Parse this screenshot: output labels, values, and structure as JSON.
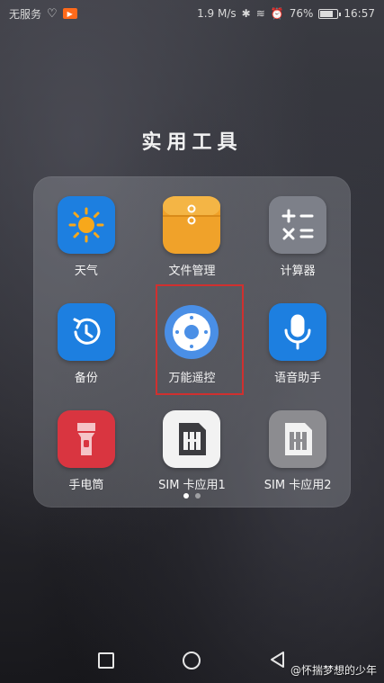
{
  "status_bar": {
    "carrier": "无服务",
    "speed": "1.9 M/s",
    "battery_percent": "76%",
    "battery_level": 0.76,
    "time": "16:57"
  },
  "folder": {
    "title": "实用工具",
    "apps": [
      {
        "label": "天气",
        "icon": "weather-icon"
      },
      {
        "label": "文件管理",
        "icon": "folder-icon"
      },
      {
        "label": "计算器",
        "icon": "calculator-icon"
      },
      {
        "label": "备份",
        "icon": "backup-icon"
      },
      {
        "label": "万能遥控",
        "icon": "remote-control-icon"
      },
      {
        "label": "语音助手",
        "icon": "microphone-icon"
      },
      {
        "label": "手电筒",
        "icon": "flashlight-icon"
      },
      {
        "label": "SIM 卡应用1",
        "icon": "sim-card-icon"
      },
      {
        "label": "SIM 卡应用2",
        "icon": "sim-card-icon"
      }
    ],
    "page_count": 2,
    "current_page": 1
  },
  "watermark": "@怀揣梦想的少年",
  "colors": {
    "weather": "#1d7fe0",
    "files": "#f0a22a",
    "calculator": "#7d8089",
    "backup": "#1d7fe0",
    "remote": "#4a8fe6",
    "voice": "#1d7fe0",
    "flashlight": "#d93540",
    "sim1": "#f2f2f2",
    "sim2": "#8c8c90",
    "highlight": "#d0302f"
  }
}
